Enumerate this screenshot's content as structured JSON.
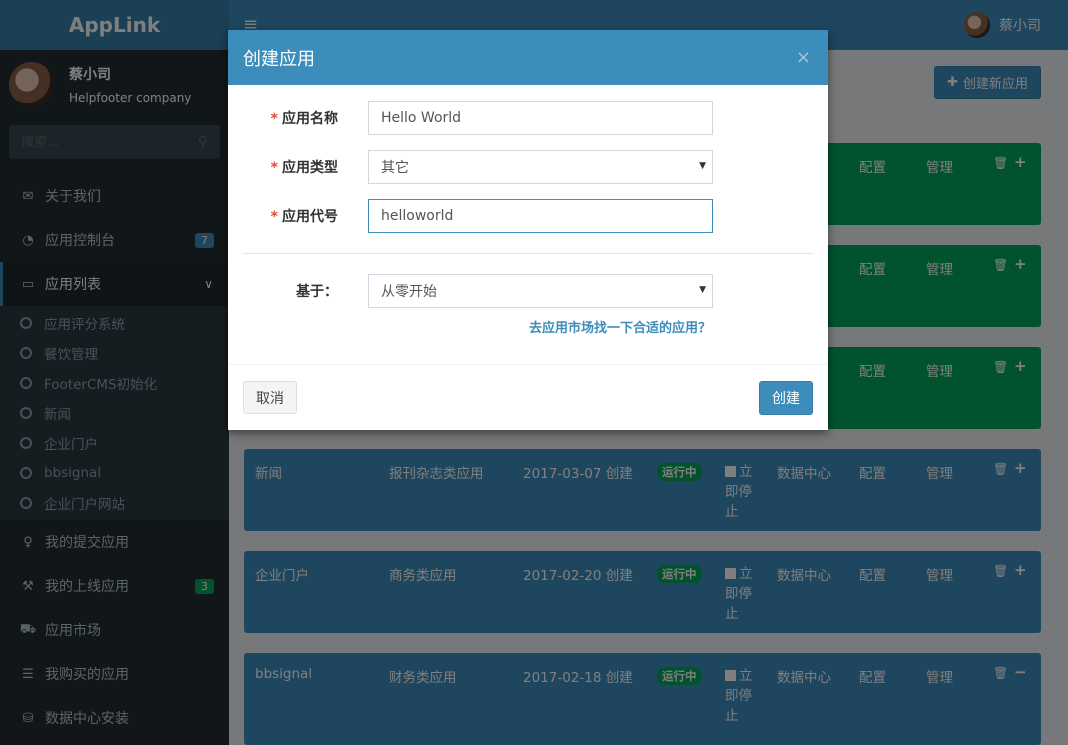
{
  "app": {
    "logo": "AppLink"
  },
  "user": {
    "name": "蔡小司",
    "company": "Helpfooter company"
  },
  "search": {
    "placeholder": "搜索..."
  },
  "sidebar": {
    "items": [
      {
        "label": "关于我们",
        "icon": "envelope-icon"
      },
      {
        "label": "应用控制台",
        "icon": "dashboard-icon",
        "badge": "7"
      },
      {
        "label": "应用列表",
        "icon": "laptop-icon"
      },
      {
        "label": "我的提交应用",
        "icon": "lightbulb-icon"
      },
      {
        "label": "我的上线应用",
        "icon": "wrench-icon",
        "badge": "3"
      },
      {
        "label": "应用市场",
        "icon": "cart-icon"
      },
      {
        "label": "我购买的应用",
        "icon": "list-icon"
      },
      {
        "label": "数据中心安装",
        "icon": "database-icon"
      }
    ],
    "subitems": [
      "应用评分系统",
      "餐饮管理",
      "FooterCMS初始化",
      "新闻",
      "企业门户",
      "bbsignal",
      "企业门户网站"
    ]
  },
  "header": {
    "user_name": "蔡小司"
  },
  "main": {
    "new_app_label": "创建新应用",
    "row_labels": {
      "data_center": "数据中心",
      "config": "配置",
      "manage": "管理",
      "status": "运行中",
      "stop": "立即停止"
    },
    "rows": [
      {
        "name": "新闻",
        "type": "报刊杂志类应用",
        "date": "2017-03-07 创建"
      },
      {
        "name": "企业门户",
        "type": "商务类应用",
        "date": "2017-02-20 创建"
      },
      {
        "name": "bbsignal",
        "type": "财务类应用",
        "date": "2017-02-18 创建"
      }
    ]
  },
  "modal": {
    "title": "创建应用",
    "close": "×",
    "fields": {
      "name_label": "应用名称",
      "name_value": "Hello World",
      "type_label": "应用类型",
      "type_value": "其它",
      "code_label": "应用代号",
      "code_value": "helloworld",
      "base_label": "基于：",
      "base_value": "从零开始"
    },
    "required_mark": "*",
    "market_link": "去应用市场找一下合适的应用？",
    "cancel_label": "取消",
    "create_label": "创建"
  },
  "colors": {
    "primary": "#3c8dbc",
    "success": "#00a65a",
    "sidebar": "#222d32",
    "danger": "#dd4b39"
  }
}
